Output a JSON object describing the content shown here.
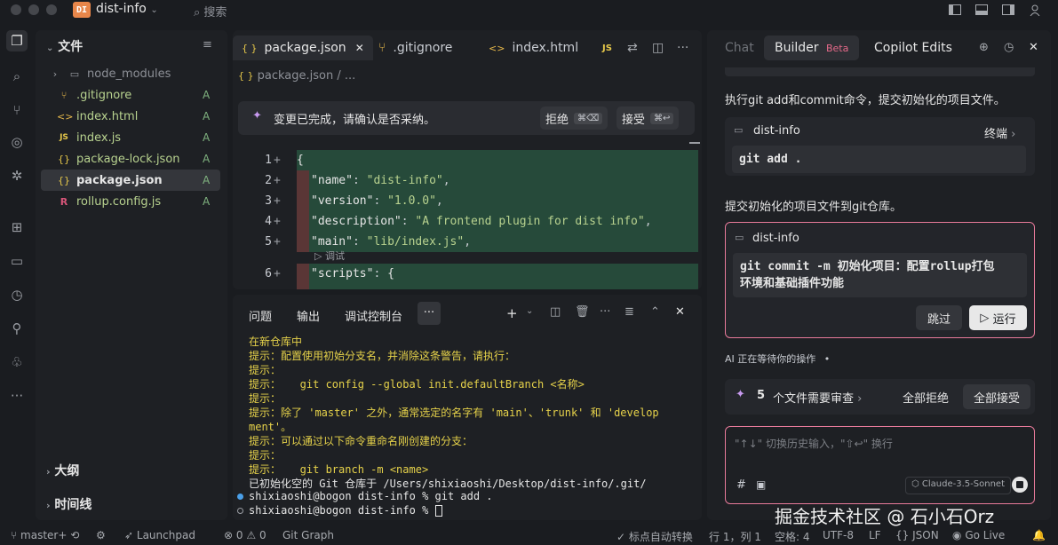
{
  "titlebar": {
    "project_badge": "DI",
    "project_name": "dist-info",
    "search": "搜索"
  },
  "explorer": {
    "title": "文件",
    "files": [
      {
        "name": "node_modules",
        "icon": "folder-icon",
        "status": ""
      },
      {
        "name": ".gitignore",
        "icon": "git-icon",
        "status": "A"
      },
      {
        "name": "index.html",
        "icon": "html-icon",
        "status": "A"
      },
      {
        "name": "index.js",
        "icon": "js-icon",
        "status": "A"
      },
      {
        "name": "package-lock.json",
        "icon": "json-icon",
        "status": "A"
      },
      {
        "name": "package.json",
        "icon": "json-icon",
        "status": "A"
      },
      {
        "name": "rollup.config.js",
        "icon": "rollup-icon",
        "status": "A"
      }
    ],
    "outline": "大纲",
    "timeline": "时间线"
  },
  "editor": {
    "tabs": [
      {
        "label": "package.json"
      },
      {
        "label": ".gitignore"
      },
      {
        "label": "index.html"
      }
    ],
    "js_badge": "JS",
    "breadcrumb": "package.json",
    "breadcrumb_more": "...",
    "json_glyph": "{ }",
    "confirm": {
      "message": "变更已完成，请确认是否采纳。",
      "reject": "拒绝",
      "reject_kbd": "⌘⌫",
      "accept": "接受",
      "accept_kbd": "⌘↩"
    },
    "lines": [
      {
        "n": "1",
        "text": "{"
      },
      {
        "n": "2",
        "key": "\"name\"",
        "val": "\"dist-info\""
      },
      {
        "n": "3",
        "key": "\"version\"",
        "val": "\"1.0.0\""
      },
      {
        "n": "4",
        "key": "\"description\"",
        "val": "\"A frontend plugin for dist info\""
      },
      {
        "n": "5",
        "key": "\"main\"",
        "val": "\"lib/index.js\""
      },
      {
        "n": "6",
        "key": "\"scripts\"",
        "val": "{"
      }
    ],
    "debug_lens": "调试"
  },
  "terminal": {
    "tabs": [
      "问题",
      "输出",
      "调试控制台"
    ],
    "more": "···",
    "lines": [
      "在新仓库中",
      "提示：配置使用初始分支名，并消除这条警告，请执行：",
      "提示：",
      "提示：   git config --global init.defaultBranch <名称>",
      "提示：",
      "提示：除了 'master' 之外，通常选定的名字有 'main'、'trunk' 和 'develop",
      "ment'。",
      "提示：可以通过以下命令重命名刚创建的分支：",
      "提示：",
      "提示：   git branch -m <name>",
      "已初始化空的 Git 仓库于 /Users/shixiaoshi/Desktop/dist-info/.git/",
      "shixiaoshi@bogon dist-info % git add .",
      "shixiaoshi@bogon dist-info % "
    ]
  },
  "panel": {
    "tabs": {
      "chat": "Chat",
      "builder": "Builder",
      "beta": "Beta",
      "copilot": "Copilot Edits"
    },
    "msg1": "执行git add和commit命令，提交初始化的项目文件。",
    "card1": {
      "title": "dist-info",
      "terminal": "终端",
      "cmd": "git add ."
    },
    "msg2": "提交初始化的项目文件到git仓库。",
    "card2": {
      "title": "dist-info",
      "cmd1": "git commit -m 初始化项目：配置rollup打包",
      "cmd2": "环境和基础插件功能",
      "skip": "跳过",
      "run": "运行"
    },
    "waiting": "AI 正在等待你的操作",
    "review": {
      "count": "5",
      "text": "个文件需要审查",
      "reject_all": "全部拒绝",
      "accept_all": "全部接受"
    },
    "input_placeholder": "\"↑↓\" 切换历史输入，\"⇧↩\" 换行",
    "model": "Claude-3.5-Sonnet"
  },
  "status": {
    "branch": "master+",
    "launchpad": "Launchpad",
    "errors": "0",
    "warnings": "0",
    "gitgraph": "Git Graph",
    "autoformat": "标点自动转换",
    "position": "行 1，列 1",
    "spaces": "空格: 4",
    "encoding": "UTF-8",
    "eol": "LF",
    "language": "JSON",
    "golive": "Go Live"
  },
  "watermark": "掘金技术社区 @ 石小石Orz"
}
